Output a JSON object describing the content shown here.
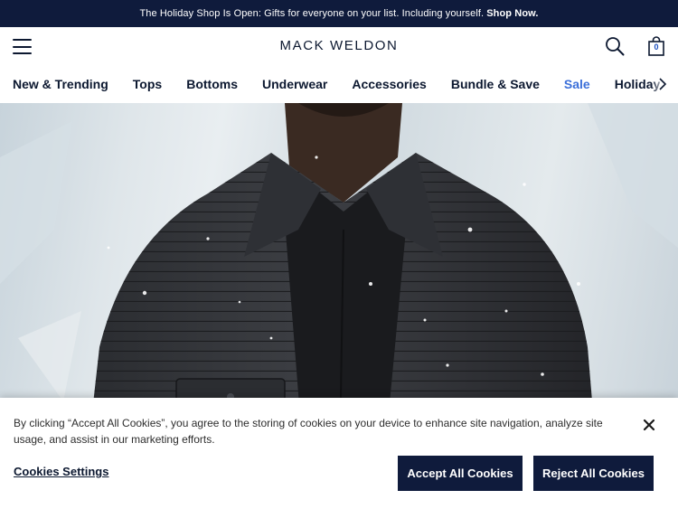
{
  "promo": {
    "text": "The Holiday Shop Is Open: Gifts for everyone on your list. Including yourself.",
    "link": "Shop Now."
  },
  "header": {
    "logo": "MACK WELDON",
    "bag_count": "0"
  },
  "nav": {
    "items": [
      {
        "label": "New & Trending"
      },
      {
        "label": "Tops"
      },
      {
        "label": "Bottoms"
      },
      {
        "label": "Underwear"
      },
      {
        "label": "Accessories"
      },
      {
        "label": "Bundle & Save"
      },
      {
        "label": "Sale"
      },
      {
        "label": "Holiday Shop"
      }
    ]
  },
  "hero": {
    "image": "man-in-black-quilted-jacket-snow"
  },
  "cookie": {
    "text": "By clicking “Accept All Cookies”, you agree to the storing of cookies on your device to enhance site navigation, analyze site usage, and assist in our marketing efforts.",
    "settings_label": "Cookies Settings",
    "accept_label": "Accept All Cookies",
    "reject_label": "Reject All Cookies"
  },
  "colors": {
    "navy": "#0f1b3c",
    "sale": "#3b6fd9"
  }
}
